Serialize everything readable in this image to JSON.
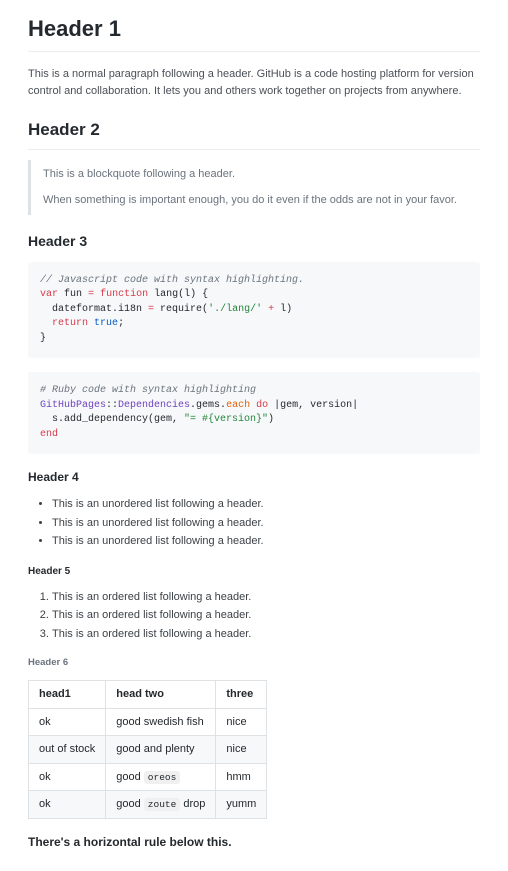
{
  "h1": "Header 1",
  "p1": "This is a normal paragraph following a header. GitHub is a code hosting platform for version control and collaboration. It lets you and others work together on projects from anywhere.",
  "h2": "Header 2",
  "bq1": "This is a blockquote following a header.",
  "bq2": "When something is important enough, you do it even if the odds are not in your favor.",
  "h3": "Header 3",
  "code_js": {
    "l1": "// Javascript code with syntax highlighting.",
    "l2a": "var",
    "l2b": " fun ",
    "l2c": "=",
    "l2d": " ",
    "l2e": "function",
    "l2f": " lang(l) {",
    "l3a": "  dateformat.i18n ",
    "l3b": "=",
    "l3c": " require(",
    "l3d": "'./lang/'",
    "l3e": " ",
    "l3f": "+",
    "l3g": " l)",
    "l4a": "  ",
    "l4b": "return",
    "l4c": " ",
    "l4d": "true",
    "l4e": ";",
    "l5": "}"
  },
  "code_rb": {
    "l1": "# Ruby code with syntax highlighting",
    "l2a": "GitHubPages",
    "l2b": "::",
    "l2c": "Dependencies",
    "l2d": ".gems.",
    "l2e": "each",
    "l2f": " ",
    "l2g": "do",
    "l2h": " |gem, version|",
    "l3a": "  s.add_dependency(gem, ",
    "l3b": "\"= #{version}\"",
    "l3c": ")",
    "l4": "end"
  },
  "h4": "Header 4",
  "ul_item": "This is an unordered list following a header.",
  "h5": "Header 5",
  "ol_item": "This is an ordered list following a header.",
  "h6": "Header 6",
  "table": {
    "head": [
      "head1",
      "head two",
      "three"
    ],
    "rows": [
      [
        "ok",
        "good swedish fish",
        "nice"
      ],
      [
        "out of stock",
        "good and plenty",
        "nice"
      ],
      [
        "ok",
        {
          "pre": "good ",
          "code": "oreos",
          "post": ""
        },
        "hmm"
      ],
      [
        "ok",
        {
          "pre": "good ",
          "code": "zoute",
          "post": " drop"
        },
        "yumm"
      ]
    ]
  },
  "hr_text": "There's a horizontal rule below this."
}
